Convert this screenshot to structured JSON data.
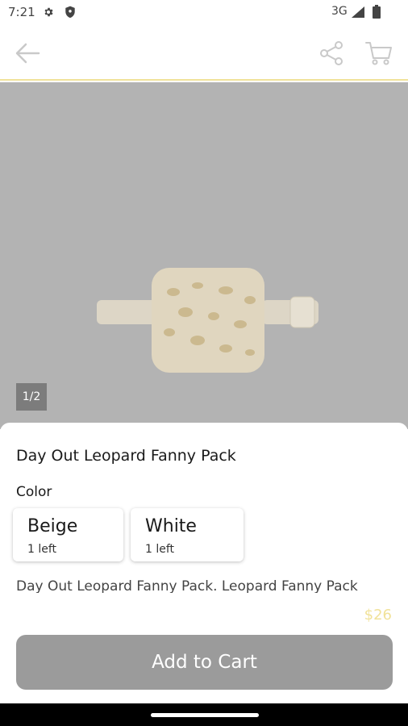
{
  "status_bar": {
    "time": "7:21",
    "network": "3G",
    "icons": [
      "gear-icon",
      "shield-icon",
      "signal-icon",
      "battery-icon"
    ]
  },
  "app_bar": {
    "icons": [
      "back-arrow-icon",
      "share-icon",
      "cart-icon"
    ],
    "accent_color": "#f1e29a"
  },
  "gallery": {
    "counter": "1/2"
  },
  "product": {
    "title": "Day Out Leopard Fanny Pack",
    "color_label": "Color",
    "options": [
      {
        "name": "Beige",
        "stock": "1 left"
      },
      {
        "name": "White",
        "stock": "1 left"
      }
    ],
    "description": "Day Out Leopard Fanny Pack. Leopard Fanny Pack",
    "price": "$26",
    "add_to_cart_label": "Add to Cart"
  },
  "colors": {
    "price": "#f1e29a",
    "button_bg": "#9b9b9b",
    "gallery_bg": "#b3b3b3"
  }
}
